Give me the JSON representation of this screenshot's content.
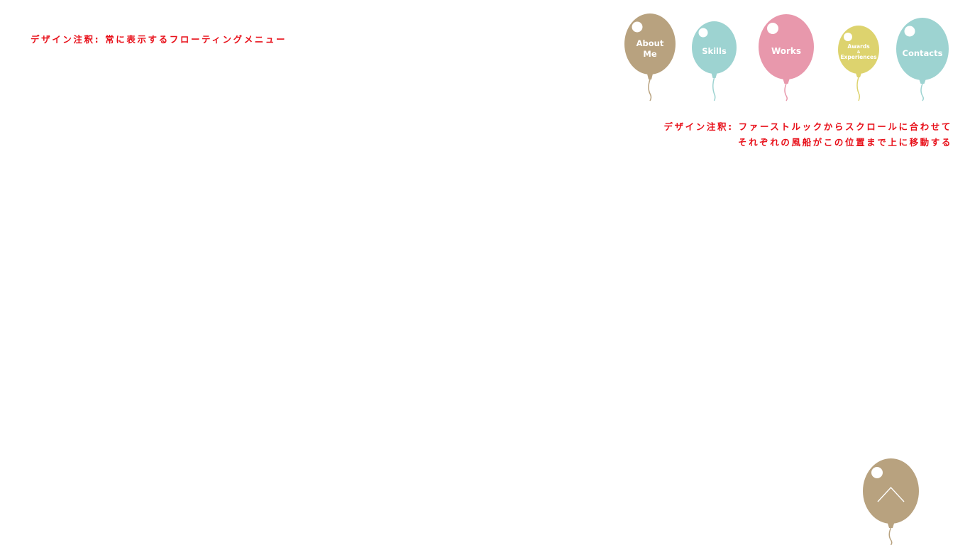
{
  "notes": {
    "floating_menu": "デザイン注釈: 常に表示するフローティングメニュー",
    "first_look_line1": "デザイン注釈: ファーストルックからスクロールに合わせて",
    "first_look_line2": "それぞれの風船がこの位置まで上に移動する"
  },
  "nav": {
    "about": {
      "line1": "About",
      "line2": "Me",
      "color": "#b8a27f"
    },
    "skills": {
      "label": "Skills",
      "color": "#9dd3d1"
    },
    "works": {
      "label": "Works",
      "color": "#e898ac"
    },
    "awards": {
      "line1": "Awards",
      "amp": "&",
      "line2": "Experiences",
      "color": "#ddd36e"
    },
    "contacts": {
      "label": "Contacts",
      "color": "#9dd3d1"
    }
  },
  "back_to_top": {
    "icon": "chevron-up-icon",
    "color": "#b8a27f"
  },
  "colors": {
    "annotation": "#e8101a",
    "highlight": "#ffffff"
  }
}
